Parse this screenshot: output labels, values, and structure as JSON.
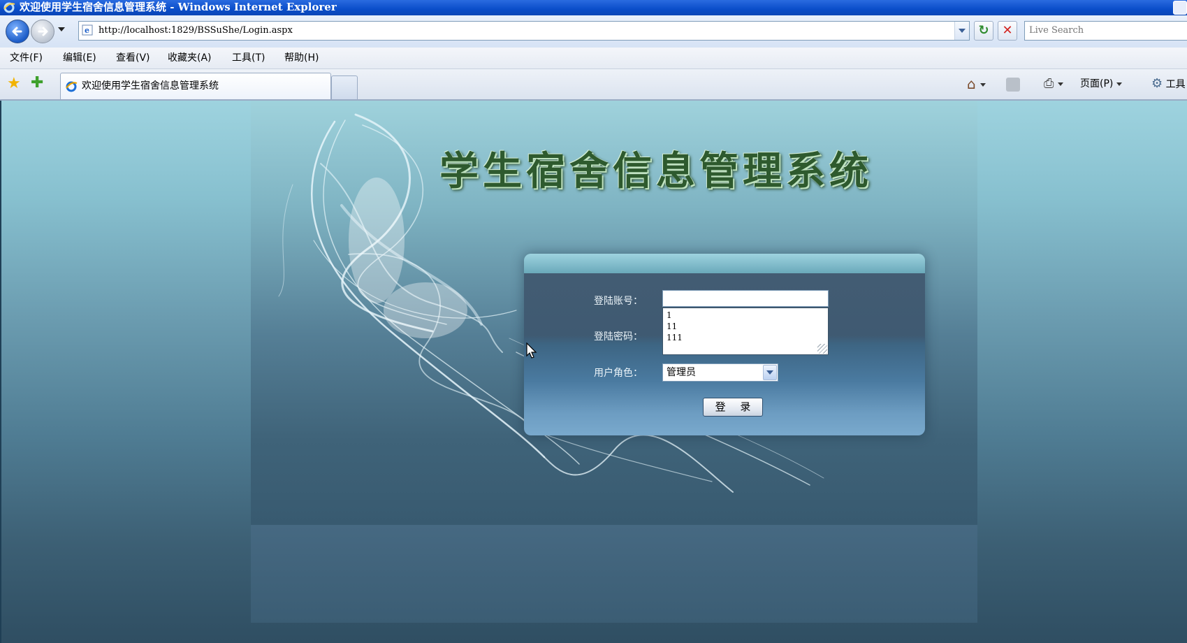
{
  "window": {
    "title": "欢迎使用学生宿舍信息管理系统 - Windows Internet Explorer"
  },
  "addressbar": {
    "url": "http://localhost:1829/BSSuShe/Login.aspx",
    "search_placeholder": "Live Search"
  },
  "menu": {
    "items": [
      "文件(F)",
      "编辑(E)",
      "查看(V)",
      "收藏夹(A)",
      "工具(T)",
      "帮助(H)"
    ]
  },
  "tabs": {
    "active_label": "欢迎使用学生宿舍信息管理系统"
  },
  "commandbar": {
    "page_label": "页面(P)",
    "tools_label": "工具"
  },
  "page": {
    "system_title": "学生宿舍信息管理系统",
    "account_label": "登陆账号：",
    "password_label": "登陆密码：",
    "role_label": "用户角色：",
    "account_value": "",
    "autocomplete_items": [
      "1",
      "11",
      "111"
    ],
    "role_selected": "管理员",
    "login_button": "登 录"
  },
  "colors": {
    "title_green": "#2e5a2e",
    "ie_blue": "#0a4dc9"
  }
}
